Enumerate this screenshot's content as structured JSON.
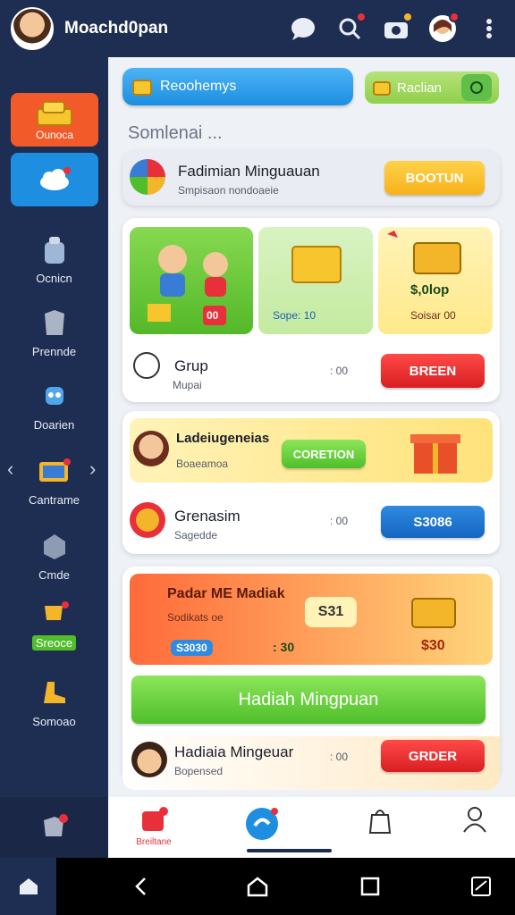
{
  "header": {
    "title": "Moachd0pan"
  },
  "sidebar": {
    "items": [
      {
        "label": "Ounoca"
      },
      {
        "label": ""
      },
      {
        "label": "Ocnicn"
      },
      {
        "label": "Prennde"
      },
      {
        "label": "Doarien"
      },
      {
        "label": "Cantrame"
      },
      {
        "label": "Cmde"
      },
      {
        "label": "Sreoce"
      },
      {
        "label": "Somoao"
      }
    ],
    "arrow_left": "‹",
    "arrow_right": "›"
  },
  "main": {
    "search_label": "Reoohemys",
    "action_label": "Raclian",
    "section_label": "Somlenai ...",
    "featured": {
      "title": "Fadimian Minguauan",
      "subtitle": "Smpisaon nondoaeie",
      "button": "BOOTUN"
    },
    "tiles": {
      "tile2_text": "Sope: 10",
      "tile3_price": "$,0lop",
      "tile3_text": "Soisar 00",
      "tile1_badge": "00"
    },
    "grup": {
      "title": "Grup",
      "subtitle": "Mupai",
      "meta": ": 00",
      "button": "BREEN"
    },
    "lade": {
      "title": "Ladeiugeneias",
      "subtitle": "Boaeamoa",
      "button": "CORETION"
    },
    "grenasim": {
      "title": "Grenasim",
      "subtitle": "Sagedde",
      "meta": ": 00",
      "button": "S3086"
    },
    "promo": {
      "title": "Padar ME Madiak",
      "subtitle": "Sodikats oe",
      "price_tag": "S31",
      "left_value": "S3030",
      "mid_value": ": 30",
      "right_value": "$30",
      "wide_button": "Hadiah Mingpuan"
    },
    "hadiaia": {
      "title": "Hadiaia Mingeuar",
      "subtitle": "Bopensed",
      "meta": ": 00",
      "button": "GRDER"
    }
  },
  "bottom_nav": {
    "items": [
      {
        "label": "Breiltane"
      },
      {
        "label": ""
      },
      {
        "label": ""
      },
      {
        "label": ""
      }
    ]
  },
  "colors": {
    "navy": "#1e2d52",
    "accent_orange": "#f25a2a",
    "accent_blue": "#1d8ee0",
    "red_button": "#d91e22",
    "green_button": "#4fbe2a",
    "yellow_button": "#f6b21a"
  }
}
